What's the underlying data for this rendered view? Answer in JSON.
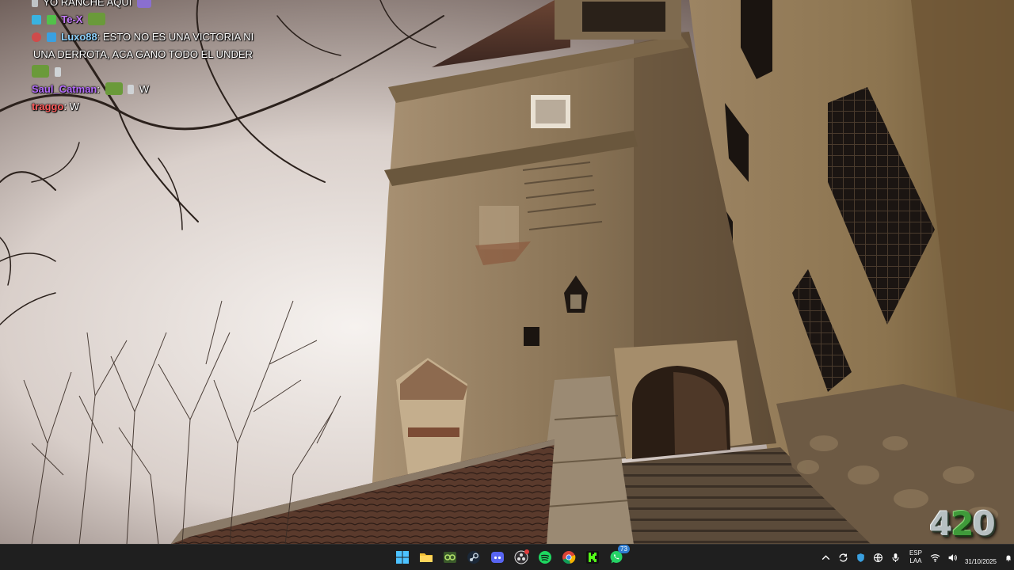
{
  "chat": {
    "lines": [
      {
        "user": "",
        "text": "YO RANCHE AQUÍ",
        "user_color": "#ffffff"
      },
      {
        "user": "Te-X",
        "text": "",
        "user_color": "#c97dff"
      },
      {
        "user": "Luxo88",
        "text": "ESTO NO ES UNA VICTORIA NI UNA DERROTA, ACA GANO TODO EL UNDER",
        "user_color": "#8fd3ff"
      },
      {
        "user": "",
        "text": "",
        "user_color": "#ffffff"
      },
      {
        "user": "Saul_Catman",
        "text": "W",
        "user_color": "#b56cff"
      },
      {
        "user": "traggo",
        "text": "W",
        "user_color": "#ff5d5d"
      }
    ],
    "luxo_line1": "ESTO NO ES UNA VICTORIA NI",
    "luxo_line2": "UNA DERROTA, ACA GANO TODO EL UNDER"
  },
  "logo": {
    "digit1": "4",
    "digit2": "2",
    "digit3": "0"
  },
  "taskbar": {
    "apps": [
      {
        "name": "Start",
        "icon": "windows-icon"
      },
      {
        "name": "File Explorer",
        "icon": "folder-icon"
      },
      {
        "name": "Game app",
        "icon": "gamepad-icon"
      },
      {
        "name": "Steam",
        "icon": "steam-icon"
      },
      {
        "name": "Discord",
        "icon": "discord-icon"
      },
      {
        "name": "OBS",
        "icon": "obs-icon"
      },
      {
        "name": "Spotify",
        "icon": "spotify-icon"
      },
      {
        "name": "Chrome",
        "icon": "chrome-icon"
      },
      {
        "name": "Kick",
        "icon": "kick-icon"
      },
      {
        "name": "WhatsApp",
        "icon": "whatsapp-icon",
        "badge": "73"
      }
    ],
    "language": {
      "line1": "ESP",
      "line2": "LAA"
    },
    "date": "31/10/2025"
  },
  "colors": {
    "taskbar_bg": "#1f1f1f",
    "accent_green": "#3f9a3a",
    "badge_blue": "#2f7dd1"
  }
}
